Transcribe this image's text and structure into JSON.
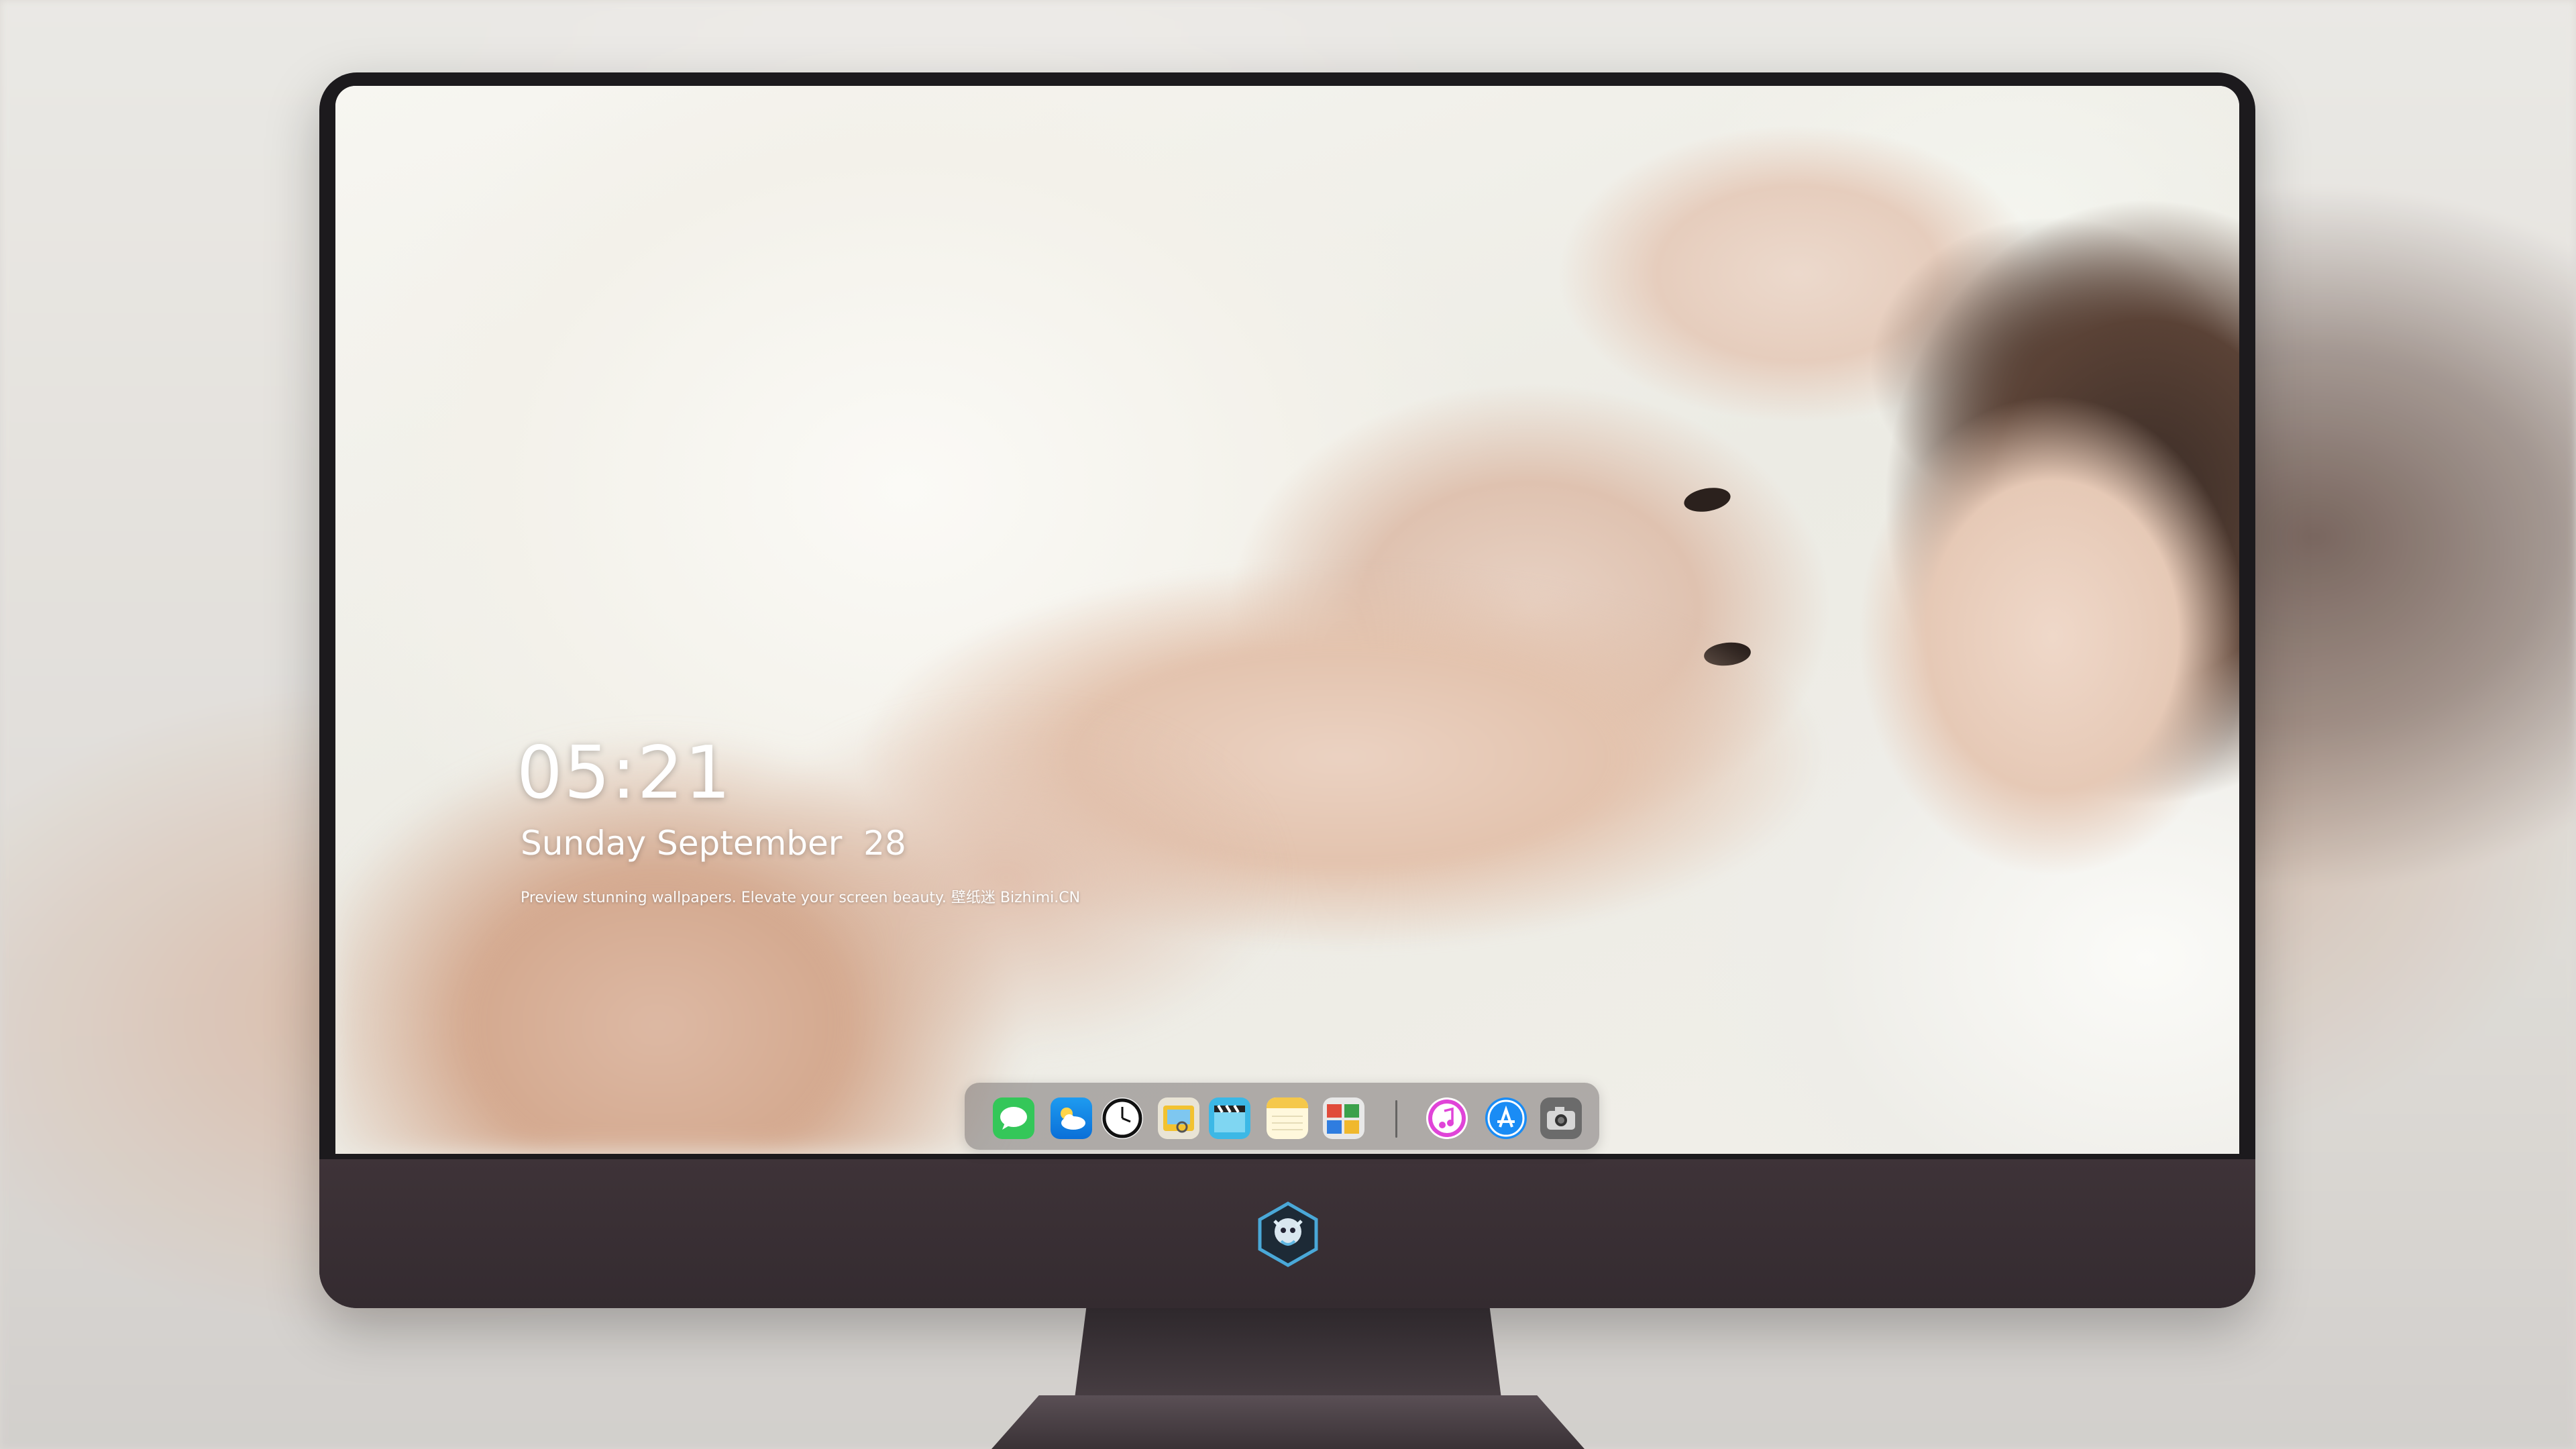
{
  "lockscreen": {
    "time": "05:21",
    "date": "Sunday September  28",
    "tagline": "Preview stunning wallpapers. Elevate your screen beauty. 壁纸迷   Bizhimi.CN"
  },
  "dock": {
    "items": [
      {
        "name": "messages-icon",
        "color": "#34c759"
      },
      {
        "name": "weather-icon",
        "color": "#1e9bf0"
      },
      {
        "name": "clock-icon",
        "color": "#111111"
      },
      {
        "name": "preview-icon",
        "color": "#f2c230"
      },
      {
        "name": "claquette-icon",
        "color": "#3cb8e6"
      },
      {
        "name": "notes-icon",
        "color": "#f5c84b"
      },
      {
        "name": "photo-booth-icon",
        "color": "#e8e8e8"
      },
      {
        "name": "itunes-icon",
        "color": "#e044d8"
      },
      {
        "name": "app-store-icon",
        "color": "#1a8cf5"
      },
      {
        "name": "camera-icon",
        "color": "#5a5a5a"
      }
    ]
  },
  "colors": {
    "bezel": "#1c1a1d",
    "chin": "#3b3136",
    "dock_bg": "rgba(120,115,115,0.55)"
  }
}
